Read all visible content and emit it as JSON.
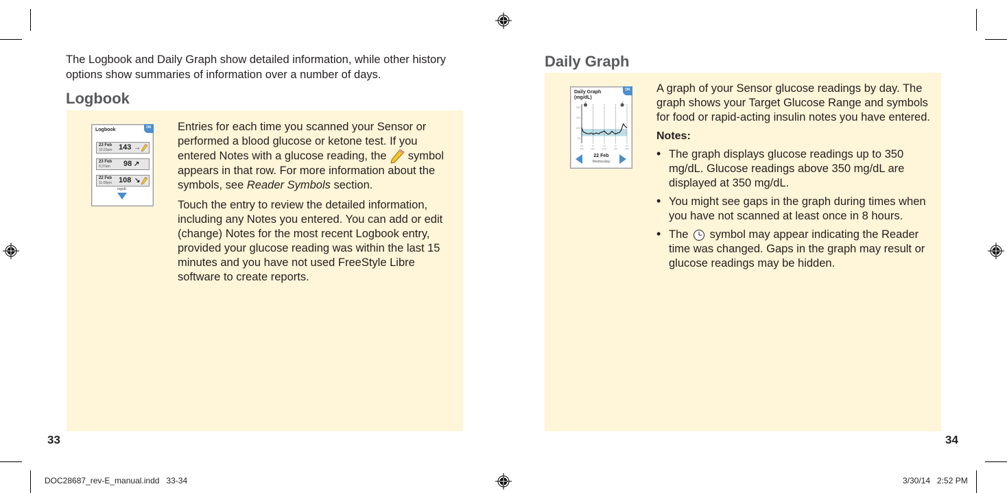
{
  "left_page": {
    "intro": "The Logbook and Daily Graph show detailed information, while other history options show summaries of information over a number of days.",
    "heading": "Logbook",
    "paragraph1_part1": "Entries for each time you scanned your Sensor or performed a blood glucose or ketone test. If you entered Notes with a glucose reading, the",
    "paragraph1_part2": "symbol appears in that row. For more information about the symbols, see",
    "paragraph1_link": "Reader Symbols",
    "paragraph1_part3": "section.",
    "paragraph2": "Touch the entry to review the detailed information, including any Notes you entered. You can add or edit (change) Notes for the most recent Logbook entry, provided your glucose reading was within the last 15 minutes and you have not used FreeStyle Libre software to create reports.",
    "page_number": "33",
    "device": {
      "title": "Logbook",
      "ok_label": "OK",
      "unit": "mg/dL",
      "entries": [
        {
          "date": "23 Feb",
          "time": "10:23am",
          "value": "143",
          "trend": "→",
          "note": true
        },
        {
          "date": "23 Feb",
          "time": "6:37am",
          "value": "98",
          "trend": "↗",
          "note": false
        },
        {
          "date": "22 Feb",
          "time": "11:09pm",
          "value": "108",
          "trend": "↘",
          "note": true
        }
      ],
      "scroll_icon": "triangle-down-icon"
    }
  },
  "right_page": {
    "heading": "Daily Graph",
    "paragraph": "A graph of your Sensor glucose readings by day. The graph shows your Target Glucose Range and symbols for food or rapid-acting insulin notes you have entered.",
    "notes_title": "Notes:",
    "bullets": [
      "The graph displays glucose readings up to 350 mg/dL. Glucose readings above 350 mg/dL are displayed at 350 mg/dL.",
      "You might see gaps in the graph during times when you have not scanned at least once in 8 hours."
    ],
    "bullet3_part1": "The",
    "bullet3_part2": "symbol may appear indicating the Reader time was changed. Gaps in the graph may result or glucose readings may be hidden.",
    "page_number": "34",
    "device": {
      "title_line1": "Daily Graph",
      "title_line2": "(mg/dL)",
      "ok_label": "OK",
      "date": "22 Feb",
      "day": "Wednesday",
      "y_ticks": [
        "350",
        "250",
        "150",
        "50"
      ],
      "x_ticks": [
        [
          "12",
          "am"
        ],
        [
          "6",
          "am"
        ],
        [
          "12",
          "pm"
        ],
        [
          "6",
          "pm"
        ],
        [
          "12",
          "am"
        ]
      ],
      "target_range": [
        70,
        140
      ],
      "food_markers_hours": [
        2,
        21.5
      ],
      "glucose_curve": [
        [
          0,
          155
        ],
        [
          0.5,
          120
        ],
        [
          1,
          110
        ],
        [
          2,
          100
        ],
        [
          3,
          95
        ],
        [
          4,
          92
        ],
        [
          5,
          100
        ],
        [
          6,
          90
        ],
        [
          7,
          95
        ],
        [
          8,
          100
        ],
        [
          9,
          92
        ],
        [
          10,
          105
        ],
        [
          11,
          110
        ],
        [
          12,
          120
        ],
        [
          13,
          100
        ],
        [
          14,
          88
        ],
        [
          15,
          95
        ],
        [
          16,
          118
        ],
        [
          17,
          100
        ],
        [
          18,
          92
        ],
        [
          19,
          100
        ],
        [
          20,
          105
        ],
        [
          21,
          130
        ],
        [
          22,
          190
        ],
        [
          23,
          165
        ],
        [
          24,
          150
        ]
      ]
    }
  },
  "footer": {
    "file_name": "DOC28687_rev-E_manual.indd   33-34",
    "timestamp": "3/30/14   2:52 PM"
  }
}
